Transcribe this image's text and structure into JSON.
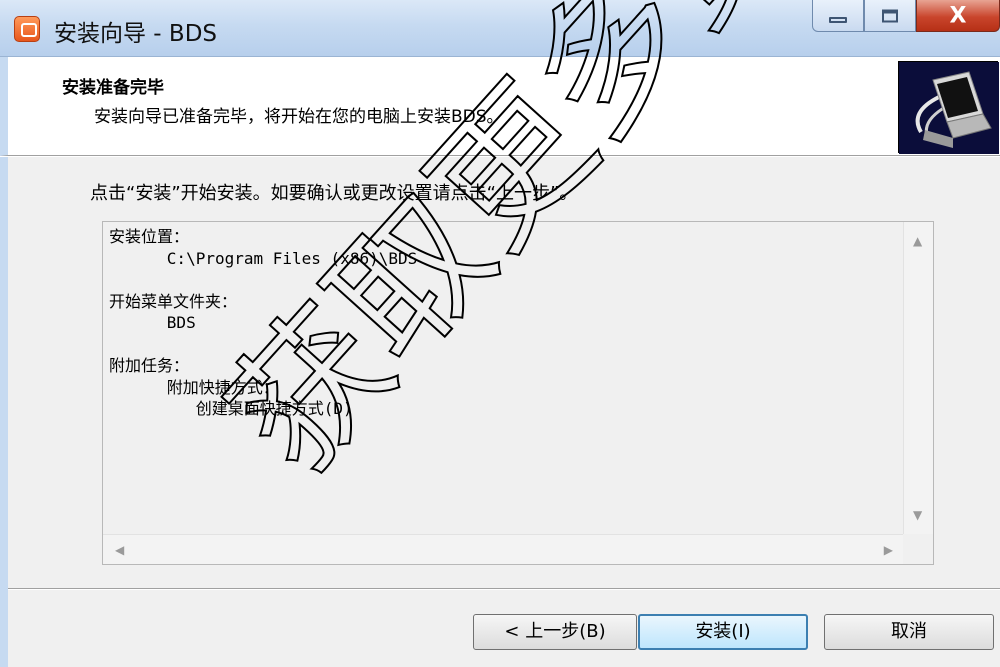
{
  "window": {
    "title": "安装向导 - BDS",
    "close_label": "X"
  },
  "header": {
    "title": "安装准备完毕",
    "subtitle": "安装向导已准备完毕，将开始在您的电脑上安装BDS。"
  },
  "body": {
    "instruction": "点击“安装”开始安装。如要确认或更改设置请点击“上一步”。",
    "memo_lines": [
      "安装位置：",
      "      C:\\Program Files (x86)\\BDS",
      "",
      "开始菜单文件夹：",
      "      BDS",
      "",
      "附加任务：",
      "      附加快捷方式：",
      "         创建桌面快捷方式(D)"
    ]
  },
  "buttons": {
    "back": "< 上一步(B)",
    "install": "安装(I)",
    "cancel": "取消"
  },
  "watermark": "获取更多资"
}
